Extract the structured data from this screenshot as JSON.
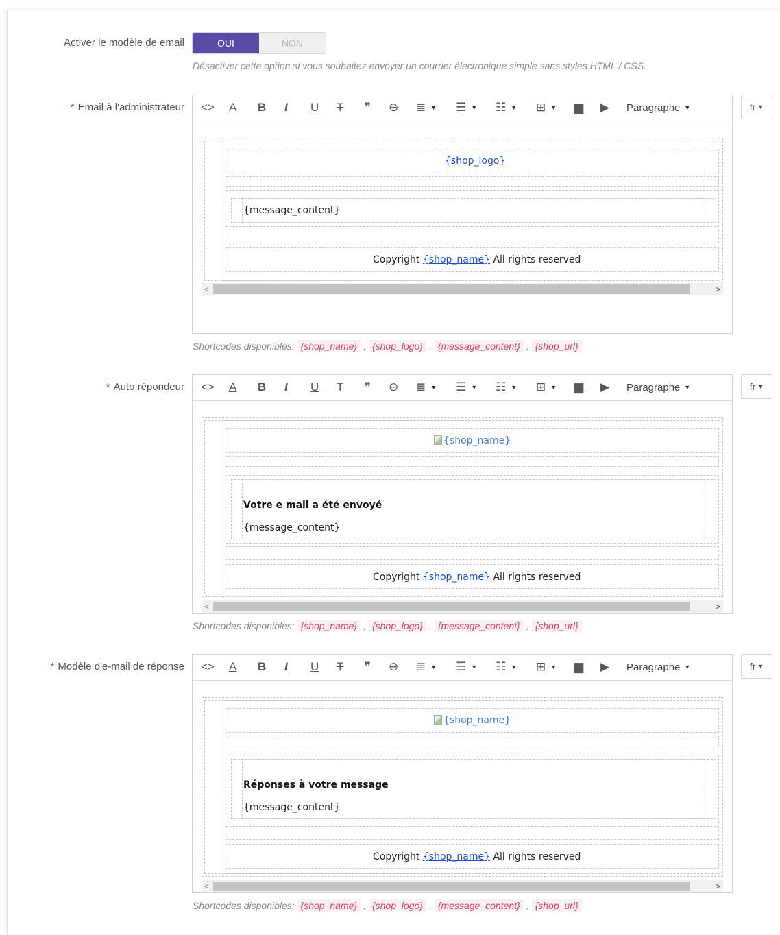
{
  "toggle": {
    "label": "Activer le modèle de email",
    "on_label": "OUI",
    "off_label": "NON",
    "help": "Désactiver cette option si vous souhaitez envoyer un courrier électronique simple sans styles HTML / CSS."
  },
  "toolbar": {
    "paragraph": "Paragraphe",
    "icons": [
      "code-icon",
      "text-color-icon",
      "bold-icon",
      "italic-icon",
      "underline-icon",
      "strikethrough-icon",
      "blockquote-icon",
      "link-icon",
      "align-icon",
      "bullet-list-icon",
      "numbered-list-icon",
      "table-icon",
      "image-icon",
      "media-icon"
    ]
  },
  "lang": "fr",
  "shortcodes": {
    "prefix": "Shortcodes disponibles:",
    "items": [
      "{shop_name}",
      "{shop_logo}",
      "{message_content}",
      "{shop_url}"
    ]
  },
  "editors": [
    {
      "label": "Email à l'administrateur",
      "logo_text": "{shop_logo}",
      "message_content": "{message_content}",
      "copyright_pre": "Copyright",
      "copyright_link": "{shop_name}",
      "copyright_post": "All rights reserved"
    },
    {
      "label": "Auto répondeur",
      "logo_alt": "{shop_name}",
      "heading": "Votre e mail a été envoyé",
      "message_content": "{message_content}",
      "copyright_pre": "Copyright",
      "copyright_link": "{shop_name}",
      "copyright_post": "All rights reserved"
    },
    {
      "label": "Modèle d'e-mail de réponse",
      "logo_alt": "{shop_name}",
      "heading": "Réponses à votre message",
      "message_content": "{message_content}",
      "copyright_pre": "Copyright",
      "copyright_link": "{shop_name}",
      "copyright_post": "All rights reserved"
    }
  ]
}
